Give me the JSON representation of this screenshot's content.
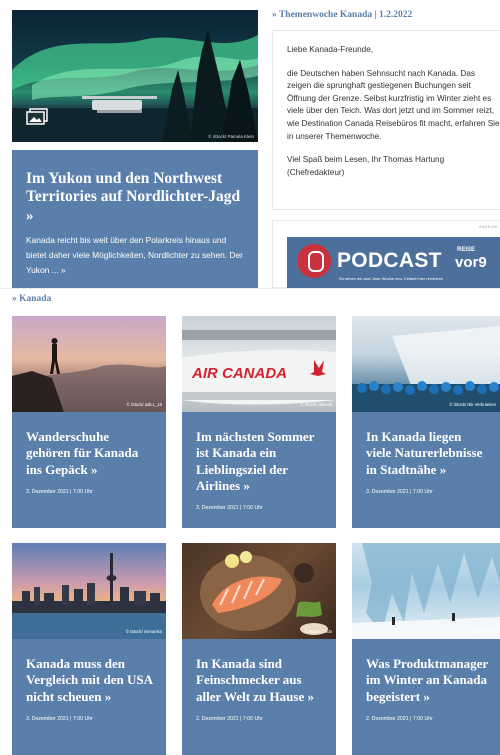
{
  "hero": {
    "title": "Im Yukon und den Northwest Territories auf Nordlichter-Jagd",
    "arrow": "»",
    "teaser": "Kanada reicht bis weit über den Polarkreis hinaus und bietet daher viele Möglichkeiten, Nordlichter zu sehen. Der Yukon ... »",
    "credit": "© iStock/ Pamela Klein",
    "gallery_icon": "image-gallery-icon"
  },
  "theme": {
    "heading": "» Themenwoche Kanada | 1.2.2022",
    "greeting": "Liebe Kanada-Freunde,",
    "body": "die Deutschen haben Sehnsucht nach Kanada. Das zeigen die sprunghaft gestiegenen Buchungen seit Öffnung der Grenze. Selbst kurzfristig im Winter zieht es viele über den Teich. Was dort jetzt und im Sommer reizt, wie Destination Canada Reisebüros fit macht, erfahren Sie in unserer Themenwoche.",
    "signoff": "Viel Spaß beim Lesen, Ihr Thomas Hartung (Chefredakteur)"
  },
  "ad": {
    "label": "ANZEIGE",
    "podcast": "PODCAST",
    "reise": "REISE",
    "vor9": "vor9",
    "sub": "So sehen wir das! Jede Woche neu. Einfach hier reinhören"
  },
  "section": {
    "heading": "» Kanada"
  },
  "cards": [
    {
      "title": "Wanderschuhe gehören für Kanada ins Gepäck",
      "arrow": "»",
      "date": "3. Dezember 2021 | 7:00 Uhr",
      "credit": "© iStock/ adiLL_15"
    },
    {
      "title": "Im nächsten Sommer ist Kanada ein Lieblingsziel der Airlines",
      "arrow": "»",
      "date": "3. Dezember 2021 | 7:00 Uhr",
      "credit": "© iStock/ ahavelf"
    },
    {
      "title": "In Kanada liegen viele Naturerlebnisse in Stadtnähe",
      "arrow": "»",
      "date": "3. Dezember 2021 | 7:00 Uhr",
      "credit": "© iStock/ Nik Verbraeken"
    },
    {
      "title": "Kanada muss den Vergleich mit den USA nicht scheuen",
      "arrow": "»",
      "date": "3. Dezember 2021 | 7:00 Uhr",
      "credit": "© iStock/ mimamka"
    },
    {
      "title": "In Kanada sind Feinschmecker aus aller Welt zu Hause",
      "arrow": "»",
      "date": "2. Dezember 2021 | 7:00 Uhr",
      "credit": "© iStock/ Ludo"
    },
    {
      "title": "Was Produktmanager im Winter an Kanada begeistert",
      "arrow": "»",
      "date": "2. Dezember 2021 | 7:00 Uhr",
      "credit": "© iStock/ Bob Hilscher"
    }
  ],
  "colors": {
    "accent": "#5b7fab",
    "podcast_red": "#c9323c"
  }
}
